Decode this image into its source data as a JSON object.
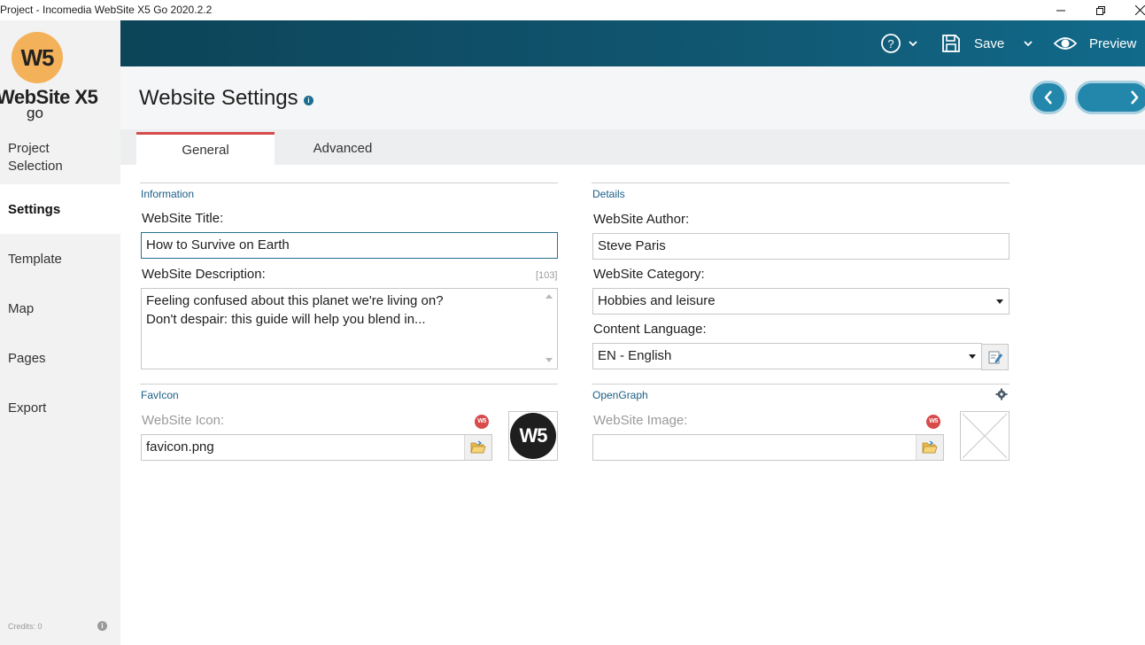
{
  "window": {
    "title": "Project - Incomedia WebSite X5 Go 2020.2.2"
  },
  "logo": {
    "name": "WebSite X5",
    "sub": "go",
    "badge": "W5"
  },
  "sidebar": {
    "items": [
      {
        "label": "Project Selection"
      },
      {
        "label": "Settings"
      },
      {
        "label": "Template"
      },
      {
        "label": "Map"
      },
      {
        "label": "Pages"
      },
      {
        "label": "Export"
      }
    ],
    "credits": "Credits: 0"
  },
  "toolbar": {
    "save_label": "Save",
    "preview_label": "Preview"
  },
  "header": {
    "title": "Website Settings"
  },
  "tabs": [
    {
      "label": "General"
    },
    {
      "label": "Advanced"
    }
  ],
  "information": {
    "section": "Information",
    "title_label": "WebSite Title:",
    "title_value": "How to Survive on Earth",
    "description_label": "WebSite Description:",
    "description_counter": "[103]",
    "description_value": "Feeling confused about this planet we're living on?\nDon't despair: this guide will help you blend in..."
  },
  "details": {
    "section": "Details",
    "author_label": "WebSite Author:",
    "author_value": "Steve Paris",
    "category_label": "WebSite Category:",
    "category_value": "Hobbies and leisure",
    "language_label": "Content Language:",
    "language_value": "EN - English"
  },
  "favicon": {
    "section": "FavIcon",
    "icon_label": "WebSite Icon:",
    "icon_value": "favicon.png",
    "badge": "W5",
    "thumb_text": "W5"
  },
  "opengraph": {
    "section": "OpenGraph",
    "image_label": "WebSite Image:",
    "image_value": "",
    "badge": "W5"
  },
  "colors": {
    "accent": "#116a8a",
    "tab_underline": "#d84b4b",
    "sidebar_bg": "#f2f2f2"
  }
}
